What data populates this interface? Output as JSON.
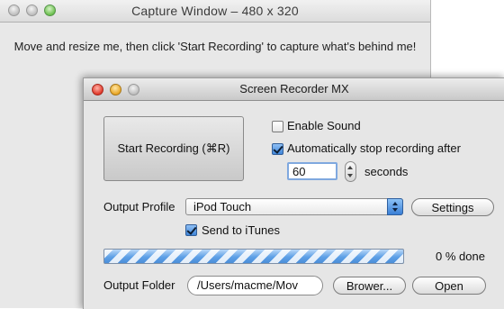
{
  "capture_window": {
    "title": "Capture Window – 480 x 320",
    "message": "Move and resize me, then click 'Start Recording' to capture what's behind me!"
  },
  "recorder": {
    "title": "Screen Recorder MX",
    "start_button": "Start Recording (⌘R)",
    "enable_sound": {
      "label": "Enable Sound",
      "checked": false
    },
    "auto_stop": {
      "label": "Automatically stop recording after",
      "checked": true
    },
    "seconds_value": "60",
    "seconds_label": "seconds",
    "output_profile": {
      "label": "Output Profile",
      "value": "iPod Touch"
    },
    "settings_button": "Settings",
    "send_to_itunes": {
      "label": "Send to iTunes",
      "checked": true
    },
    "progress_text": "0 % done",
    "output_folder": {
      "label": "Output Folder",
      "path": "/Users/macme/Mov"
    },
    "browse_button": "Brower...",
    "open_button": "Open"
  },
  "colors": {
    "accent_blue": "#3a7fd6",
    "close_red": "#e1392a",
    "minimize_yellow": "#e8a524",
    "zoom_green": "#6bbf4e"
  }
}
